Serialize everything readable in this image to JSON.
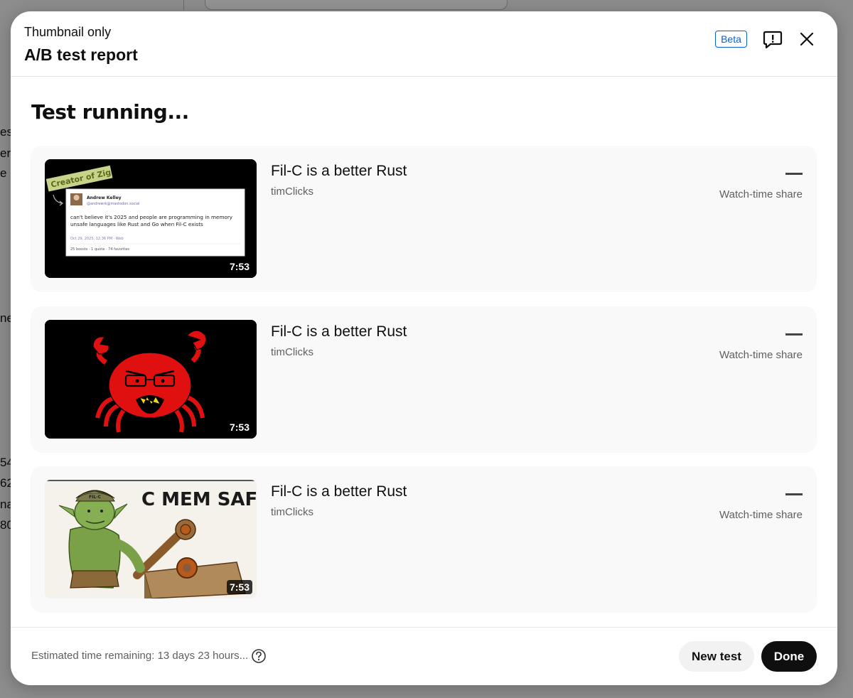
{
  "background": {
    "fragments": [
      "ess",
      "er",
      "e l",
      "ne",
      "54",
      "62",
      "na",
      "80"
    ]
  },
  "dialog": {
    "subtitle": "Thumbnail only",
    "title": "A/B test report",
    "badge": "Beta",
    "icons": {
      "feedback": "feedback-icon",
      "close": "close-icon"
    }
  },
  "body": {
    "status": "Test running..."
  },
  "variants": [
    {
      "title": "Fil-C is a better Rust",
      "channel": "timClicks",
      "duration": "7:53",
      "metric_value": "—",
      "metric_label": "Watch-time share",
      "thumb": {
        "tag": "Creator of Zig",
        "author": "Andrew Kelley",
        "handle": "@andrewrk@mastodon.social",
        "post_line1": "can't believe it's 2025 and people are programming in memory",
        "post_line2": "unsafe languages like Rust and Go when Fil-C exists",
        "post_meta": "Oct 29, 2025, 12:36 PM · Web",
        "post_stats": "25 boosts · 1 quote · 74 favorites"
      }
    },
    {
      "title": "Fil-C is a better Rust",
      "channel": "timClicks",
      "duration": "7:53",
      "metric_value": "—",
      "metric_label": "Watch-time share",
      "thumb": {
        "illustration": "angry-red-crab"
      }
    },
    {
      "title": "Fil-C is a better Rust",
      "channel": "timClicks",
      "duration": "7:53",
      "metric_value": "—",
      "metric_label": "Watch-time share",
      "thumb": {
        "caption": "C MEM SAFE",
        "hat_label": "FIL-C"
      }
    }
  ],
  "footer": {
    "eta": "Estimated time remaining: 13 days 23 hours...",
    "help_icon": "help-circle-icon",
    "new_test": "New test",
    "done": "Done"
  },
  "colors": {
    "accent": "#065fd4",
    "primary_button": "#0f0f0f",
    "card_bg": "#f9f9f9",
    "crab": "#e01010"
  }
}
